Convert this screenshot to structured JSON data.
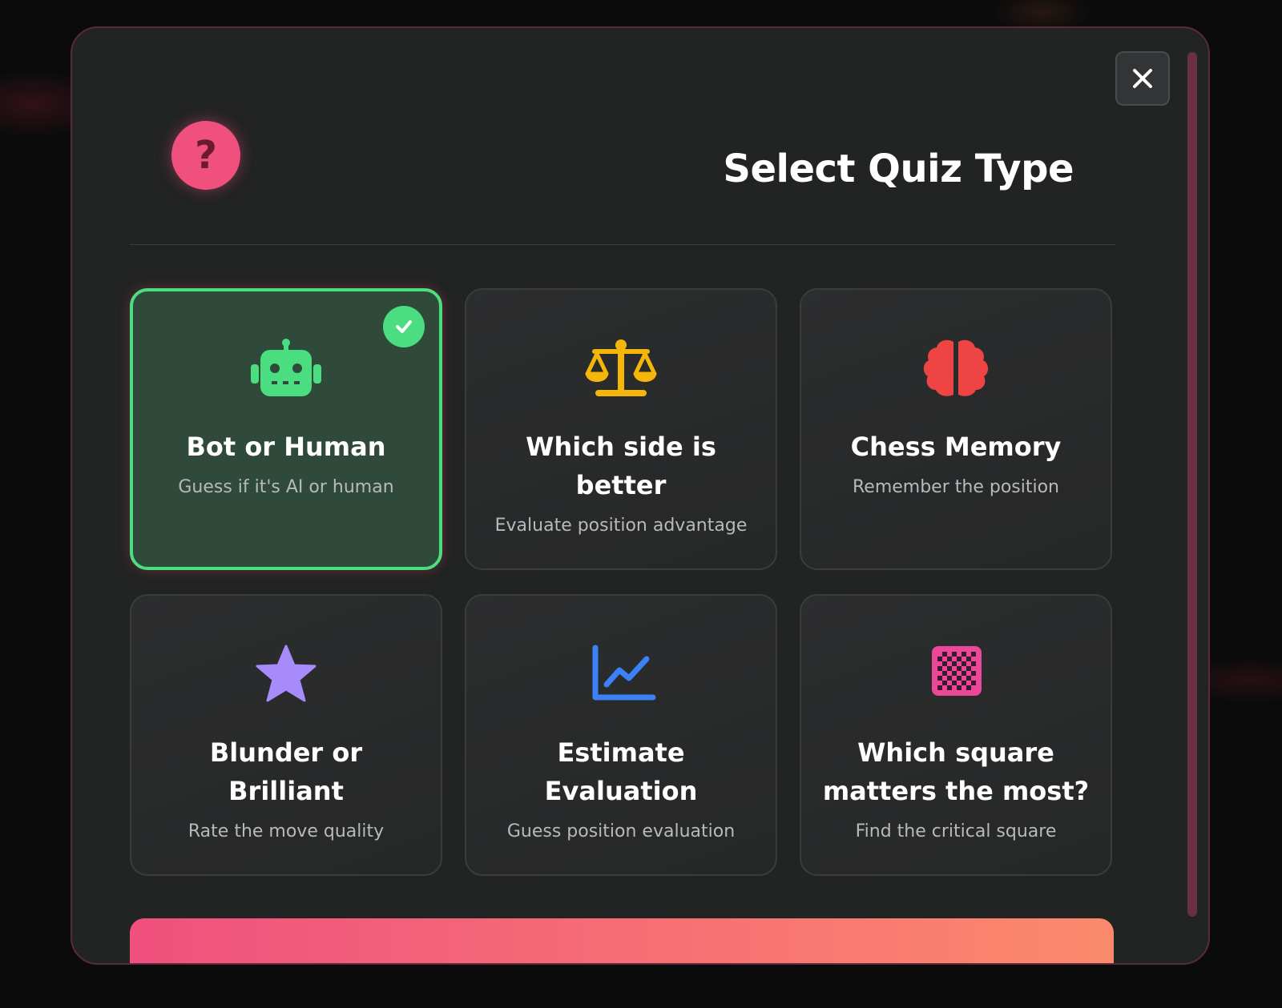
{
  "dialog": {
    "title": "Select Quiz Type",
    "header_icon": "question-mark-icon",
    "header_glyph": "?",
    "close_icon": "close-icon"
  },
  "quiz_types": [
    {
      "title": "Bot or Human",
      "description": "Guess if it's AI or human",
      "icon": "robot-icon",
      "icon_color": "#4ade80",
      "selected": true
    },
    {
      "title": "Which side is better",
      "description": "Evaluate position advantage",
      "icon": "scale-icon",
      "icon_color": "#f5b60a",
      "selected": false
    },
    {
      "title": "Chess Memory",
      "description": "Remember the position",
      "icon": "brain-icon",
      "icon_color": "#ef4444",
      "selected": false
    },
    {
      "title": "Blunder or Brilliant",
      "description": "Rate the move quality",
      "icon": "star-icon",
      "icon_color": "#a78bfa",
      "selected": false
    },
    {
      "title": "Estimate Evaluation",
      "description": "Guess position evaluation",
      "icon": "chart-line-icon",
      "icon_color": "#3b82f6",
      "selected": false
    },
    {
      "title": "Which square matters the most?",
      "description": "Find the critical square",
      "icon": "chessboard-icon",
      "icon_color": "#ec4899",
      "selected": false
    }
  ],
  "colors": {
    "accent_pink": "#f0507e",
    "selected_green": "#4ade80",
    "button_gradient_end": "#fb8a6c"
  }
}
